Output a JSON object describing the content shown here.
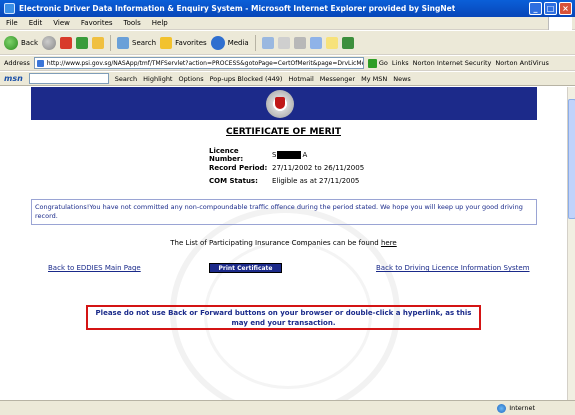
{
  "window": {
    "title": "Electronic Driver Data Information & Enquiry System - Microsoft Internet Explorer provided by SingNet",
    "minimize": "_",
    "maximize": "□",
    "close": "×"
  },
  "menubar": {
    "items": [
      "File",
      "Edit",
      "View",
      "Favorites",
      "Tools",
      "Help"
    ]
  },
  "toolbar": {
    "back_label": "Back",
    "search_label": "Search",
    "favorites_label": "Favorites",
    "media_label": "Media"
  },
  "addressbar": {
    "label": "Address",
    "url": "http://www.psi.gov.sg/NASApp/tmf/TMFServlet?action=PROCESS&gotoPage=CertOfMerit&page=DrvLicMenu",
    "go_label": "Go",
    "links_label": "Links",
    "norton_security": "Norton Internet Security",
    "norton_antivirus": "Norton AntiVirus"
  },
  "msnbar": {
    "logo": "msn",
    "search_label": "Search",
    "highlight_label": "Highlight",
    "options_label": "Options",
    "popups_label": "Pop-ups Blocked (449)",
    "hotmail_label": "Hotmail",
    "messenger_label": "Messenger",
    "mymsn_label": "My MSN",
    "news_label": "News"
  },
  "page": {
    "certificate_title": "CERTIFICATE OF MERIT",
    "licence_label": "Licence Number:",
    "licence_prefix": "S",
    "licence_suffix": "A",
    "period_label": "Record Period:",
    "period_value": "27/11/2002 to 26/11/2005",
    "status_label": "COM Status:",
    "status_value": "Eligible as at 27/11/2005",
    "congrats": "Congratulations!You have not committed any non-compoundable traffic offence during the period stated. We hope you will keep up your good driving record.",
    "insurance_text": "The List of Participating Insurance Companies can be found",
    "insurance_link": "here",
    "back_link": "Back to EDDIES Main Page",
    "print_button": "Print Certificate",
    "driving_link": "Back to Driving Licence Information System",
    "warning": "Please do not use Back or Forward buttons on your browser or double-click a hyperlink, as this may end your transaction."
  },
  "statusbar": {
    "zone": "Internet"
  }
}
